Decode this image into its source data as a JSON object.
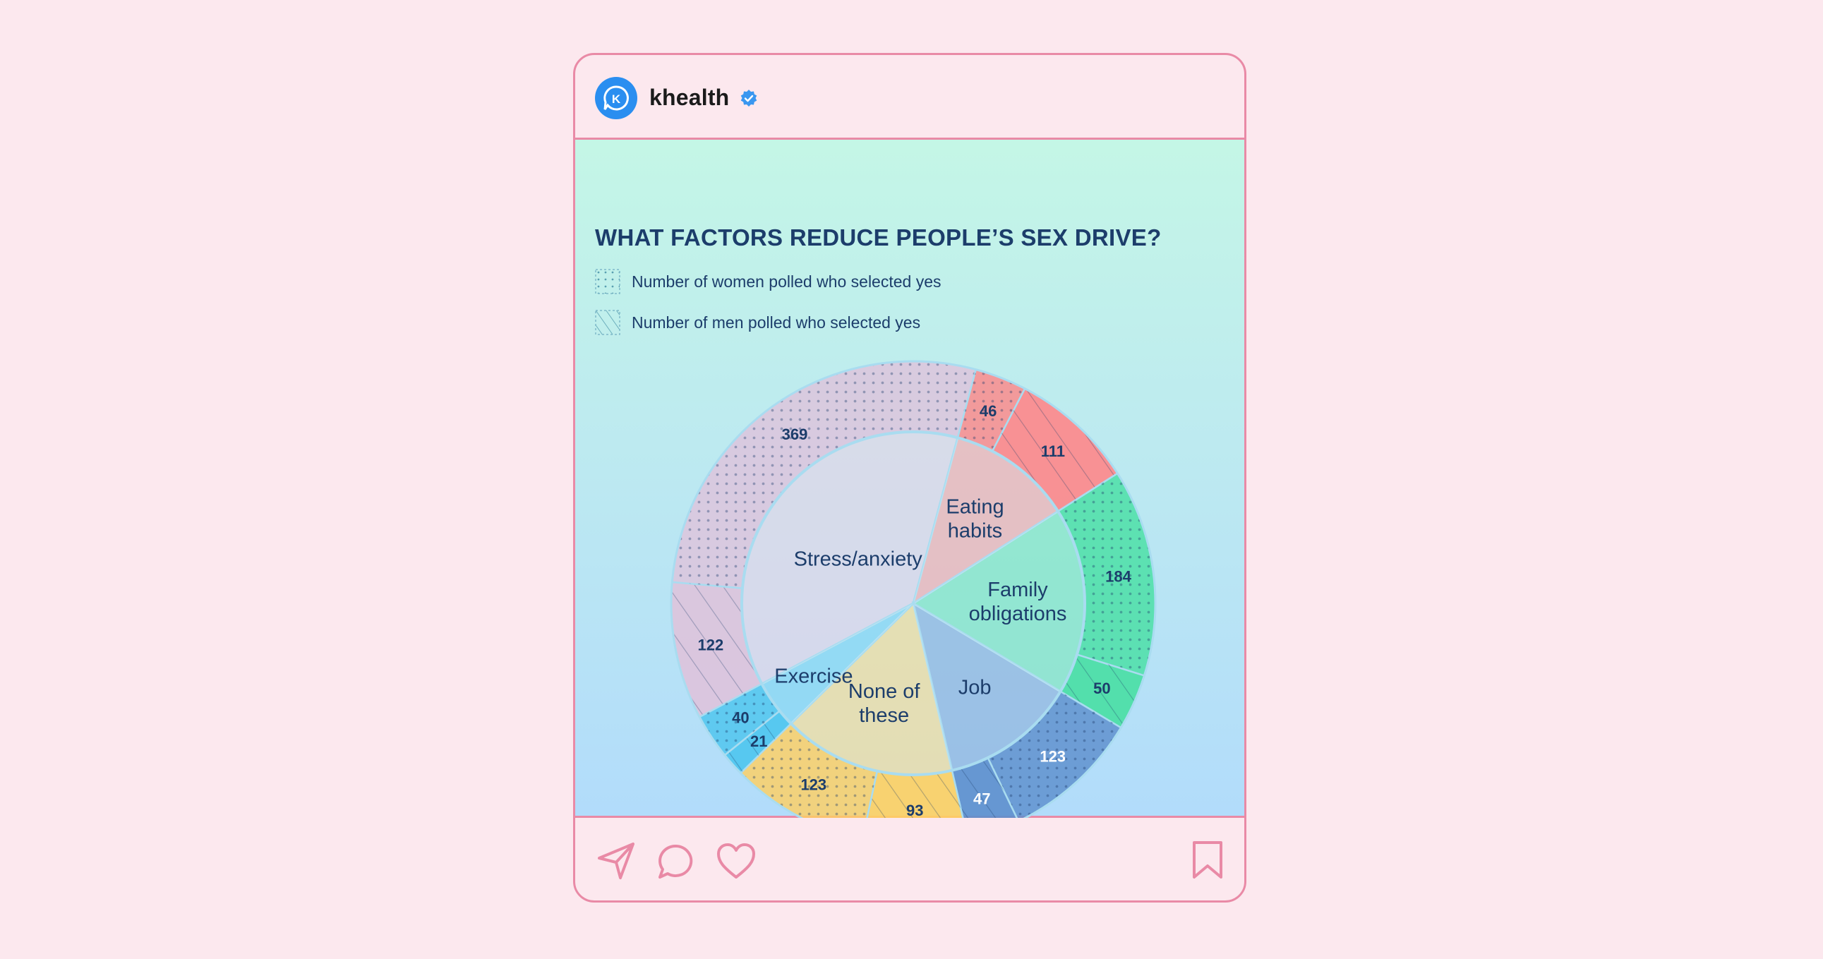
{
  "post": {
    "account_name": "khealth",
    "avatar_letter": "K"
  },
  "colors": {
    "stress": "#dec3dc",
    "eating": "#fe8789",
    "family": "#48dfa3",
    "job": "#5d8fcd",
    "none": "#ffd061",
    "exercise": "#4cc5ee",
    "text": "#1c3d6b",
    "border": "#e98aa6",
    "verified": "#2a8ef0"
  },
  "chart_data": {
    "type": "pie",
    "title": "WHAT FACTORS REDUCE PEOPLE’S SEX DRIVE?",
    "legend": {
      "women": "Number of women polled who selected yes",
      "men": "Number of men polled who selected yes"
    },
    "categories": [
      {
        "key": "stress",
        "label": "Stress/anxiety",
        "lines": [
          "Stress/anxiety"
        ],
        "women": 369,
        "men": 122
      },
      {
        "key": "eating",
        "label": "Eating habits",
        "lines": [
          "Eating",
          "habits"
        ],
        "women": 46,
        "men": 111
      },
      {
        "key": "family",
        "label": "Family obligations",
        "lines": [
          "Family",
          "obligations"
        ],
        "women": 184,
        "men": 50
      },
      {
        "key": "job",
        "label": "Job",
        "lines": [
          "Job"
        ],
        "women": 123,
        "men": 47
      },
      {
        "key": "none",
        "label": "None of these",
        "lines": [
          "None of",
          "these"
        ],
        "women": 123,
        "men": 93
      },
      {
        "key": "exercise",
        "label": "Exercise",
        "lines": [
          "Exercise"
        ],
        "women": 40,
        "men": 21
      }
    ]
  }
}
